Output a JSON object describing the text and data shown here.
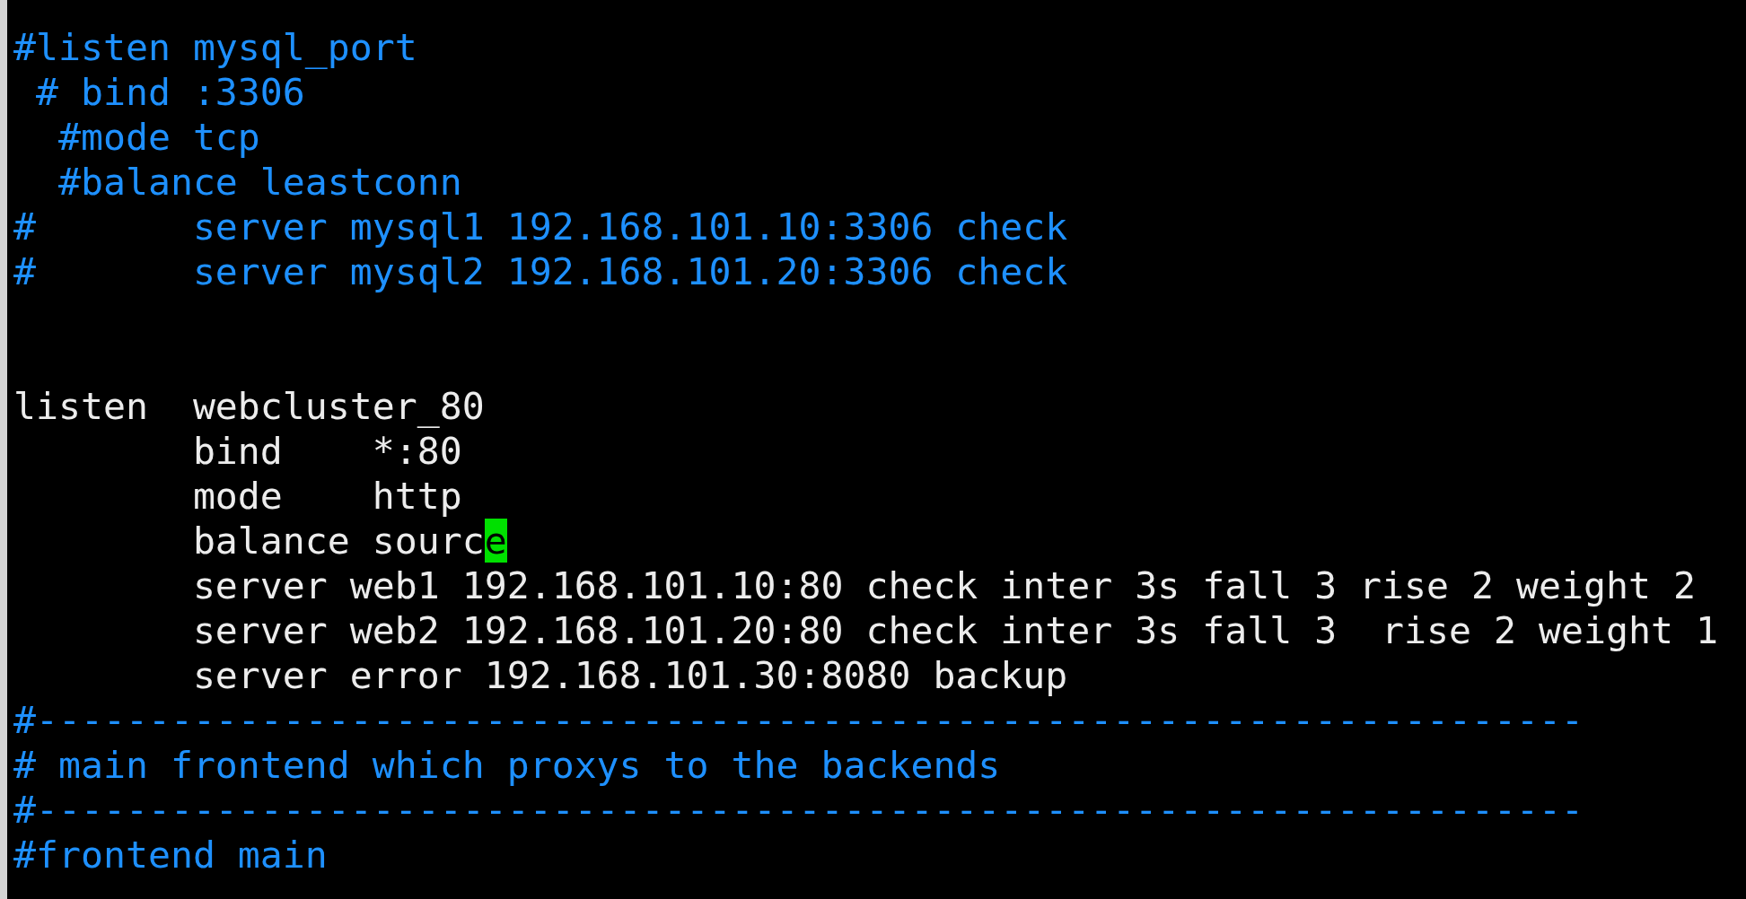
{
  "lines": [
    {
      "kind": "comment",
      "segments": [
        {
          "text": "#listen mysql_port",
          "cursor": false
        }
      ]
    },
    {
      "kind": "comment",
      "segments": [
        {
          "text": " # bind :3306",
          "cursor": false
        }
      ]
    },
    {
      "kind": "comment",
      "segments": [
        {
          "text": "  #mode tcp",
          "cursor": false
        }
      ]
    },
    {
      "kind": "comment",
      "segments": [
        {
          "text": "  #balance leastconn",
          "cursor": false
        }
      ]
    },
    {
      "kind": "comment",
      "segments": [
        {
          "text": "#       server mysql1 192.168.101.10:3306 check",
          "cursor": false
        }
      ]
    },
    {
      "kind": "comment",
      "segments": [
        {
          "text": "#       server mysql2 192.168.101.20:3306 check",
          "cursor": false
        }
      ]
    },
    {
      "kind": "blank"
    },
    {
      "kind": "blank"
    },
    {
      "kind": "code",
      "segments": [
        {
          "text": "listen  webcluster_80",
          "cursor": false
        }
      ]
    },
    {
      "kind": "code",
      "segments": [
        {
          "text": "        bind    *:80",
          "cursor": false
        }
      ]
    },
    {
      "kind": "code",
      "segments": [
        {
          "text": "        mode    http",
          "cursor": false
        }
      ]
    },
    {
      "kind": "code",
      "segments": [
        {
          "text": "        balance sourc",
          "cursor": false
        },
        {
          "text": "e",
          "cursor": true
        }
      ]
    },
    {
      "kind": "code",
      "segments": [
        {
          "text": "        server web1 192.168.101.10:80 check inter 3s fall 3 rise 2 weight 2",
          "cursor": false
        }
      ]
    },
    {
      "kind": "code",
      "segments": [
        {
          "text": "        server web2 192.168.101.20:80 check inter 3s fall 3  rise 2 weight 1",
          "cursor": false
        }
      ]
    },
    {
      "kind": "code",
      "segments": [
        {
          "text": "        server error 192.168.101.30:8080 backup",
          "cursor": false
        }
      ]
    },
    {
      "kind": "comment",
      "segments": [
        {
          "text": "#---------------------------------------------------------------------",
          "cursor": false
        }
      ]
    },
    {
      "kind": "comment",
      "segments": [
        {
          "text": "# main frontend which proxys to the backends",
          "cursor": false
        }
      ]
    },
    {
      "kind": "comment",
      "segments": [
        {
          "text": "#---------------------------------------------------------------------",
          "cursor": false
        }
      ]
    },
    {
      "kind": "comment",
      "segments": [
        {
          "text": "#frontend main",
          "cursor": false
        }
      ]
    }
  ]
}
